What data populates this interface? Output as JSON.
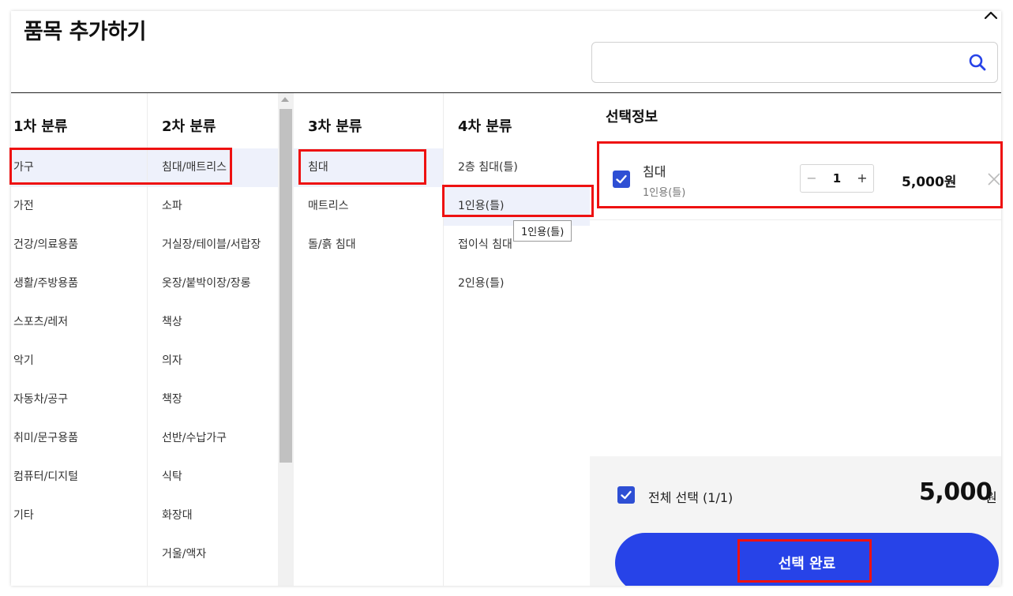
{
  "header": {
    "title": "품목 추가하기",
    "search": {
      "value": "",
      "placeholder": ""
    }
  },
  "columns": [
    {
      "title": "1차 분류",
      "selected_index": 0,
      "items": [
        "가구",
        "가전",
        "건강/의료용품",
        "생활/주방용품",
        "스포츠/레저",
        "악기",
        "자동차/공구",
        "취미/문구용품",
        "컴퓨터/디지털",
        "기타"
      ]
    },
    {
      "title": "2차 분류",
      "selected_index": 0,
      "items": [
        "침대/매트리스",
        "소파",
        "거실장/테이블/서랍장",
        "옷장/붙박이장/장롱",
        "책상",
        "의자",
        "책장",
        "선반/수납가구",
        "식탁",
        "화장대",
        "거울/액자"
      ]
    },
    {
      "title": "3차 분류",
      "selected_index": 0,
      "items": [
        "침대",
        "매트리스",
        "돌/흙 침대"
      ]
    },
    {
      "title": "4차 분류",
      "selected_index": 1,
      "items": [
        "2층 침대(틀)",
        "1인용(틀)",
        "접이식 침대",
        "2인용(틀)"
      ]
    }
  ],
  "tooltip": {
    "text": "1인용(틀)"
  },
  "selection_panel": {
    "title": "선택정보",
    "item": {
      "checked": true,
      "name": "침대",
      "option": "1인용(틀)",
      "quantity": "1",
      "minus": "−",
      "plus": "+",
      "price": "5,000원"
    },
    "select_all_label": "전체 선택 (1/1)",
    "total_value": "5,000",
    "total_unit": "원",
    "complete_button": "선택 완료"
  },
  "colors": {
    "accent": "#2743e8",
    "checkbox": "#2e4fd4",
    "highlight_border": "#ee1111",
    "selected_row": "#eef1fb",
    "footer_bg": "#f4f4f4"
  },
  "icons": [
    "collapse-chevron-up-icon",
    "search-icon",
    "checkbox-checked-icon",
    "close-icon"
  ]
}
